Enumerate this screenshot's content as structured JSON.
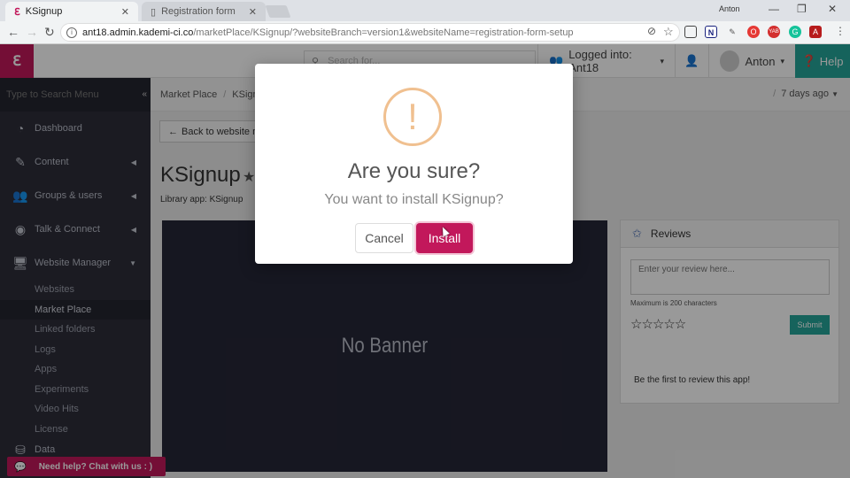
{
  "browser": {
    "tabs": [
      {
        "title": "KSignup",
        "active": true
      },
      {
        "title": "Registration form",
        "active": false
      }
    ],
    "window_user": "Anton",
    "url_host": "ant18.admin.kademi-ci.co",
    "url_path": "/marketPlace/KSignup/?websiteBranch=version1&websiteName=registration-form-setup",
    "extensions": [
      "cast-icon",
      "n-icon",
      "pen-icon",
      "opera-icon",
      "yab-icon",
      "grammarly-icon",
      "pdf-icon",
      "menu-icon"
    ]
  },
  "header": {
    "search_placeholder": "Search for...",
    "logged_into": "Logged into: Ant18",
    "user_name": "Anton",
    "help_label": "Help"
  },
  "sidebar": {
    "search_placeholder": "Type to Search Menu",
    "items": [
      {
        "label": "Dashboard",
        "icon": "dashboard-icon"
      },
      {
        "label": "Content",
        "icon": "edit-icon"
      },
      {
        "label": "Groups & users",
        "icon": "users-icon"
      },
      {
        "label": "Talk & Connect",
        "icon": "rss-icon"
      },
      {
        "label": "Website Manager",
        "icon": "desktop-icon"
      }
    ],
    "subitems": [
      "Websites",
      "Market Place",
      "Linked folders",
      "Logs",
      "Apps",
      "Experiments",
      "Video Hits",
      "License"
    ],
    "active_subitem": "Market Place",
    "partial_item": "Data"
  },
  "main": {
    "breadcrumb": [
      "Market Place",
      "KSignup"
    ],
    "time_ago": "7 days ago",
    "back_label": "Back to website m",
    "app_title": "KSignup",
    "library_app": "Library app: KSignup",
    "banner_text": "No Banner"
  },
  "reviews": {
    "title": "Reviews",
    "placeholder": "Enter your review here...",
    "max_chars": "Maximum is 200 characters",
    "stars": "☆☆☆☆☆",
    "submit_label": "Submit",
    "first_review": "Be the first to review this app!"
  },
  "chat": {
    "label": "Need help? Chat with us : )"
  },
  "modal": {
    "icon_glyph": "!",
    "title": "Are you sure?",
    "text": "You want to install KSignup?",
    "cancel_label": "Cancel",
    "install_label": "Install"
  },
  "colors": {
    "brand": "#c2185b",
    "teal": "#26a69a",
    "sidebar": "#2d2e3a",
    "warning": "#f0c090"
  }
}
